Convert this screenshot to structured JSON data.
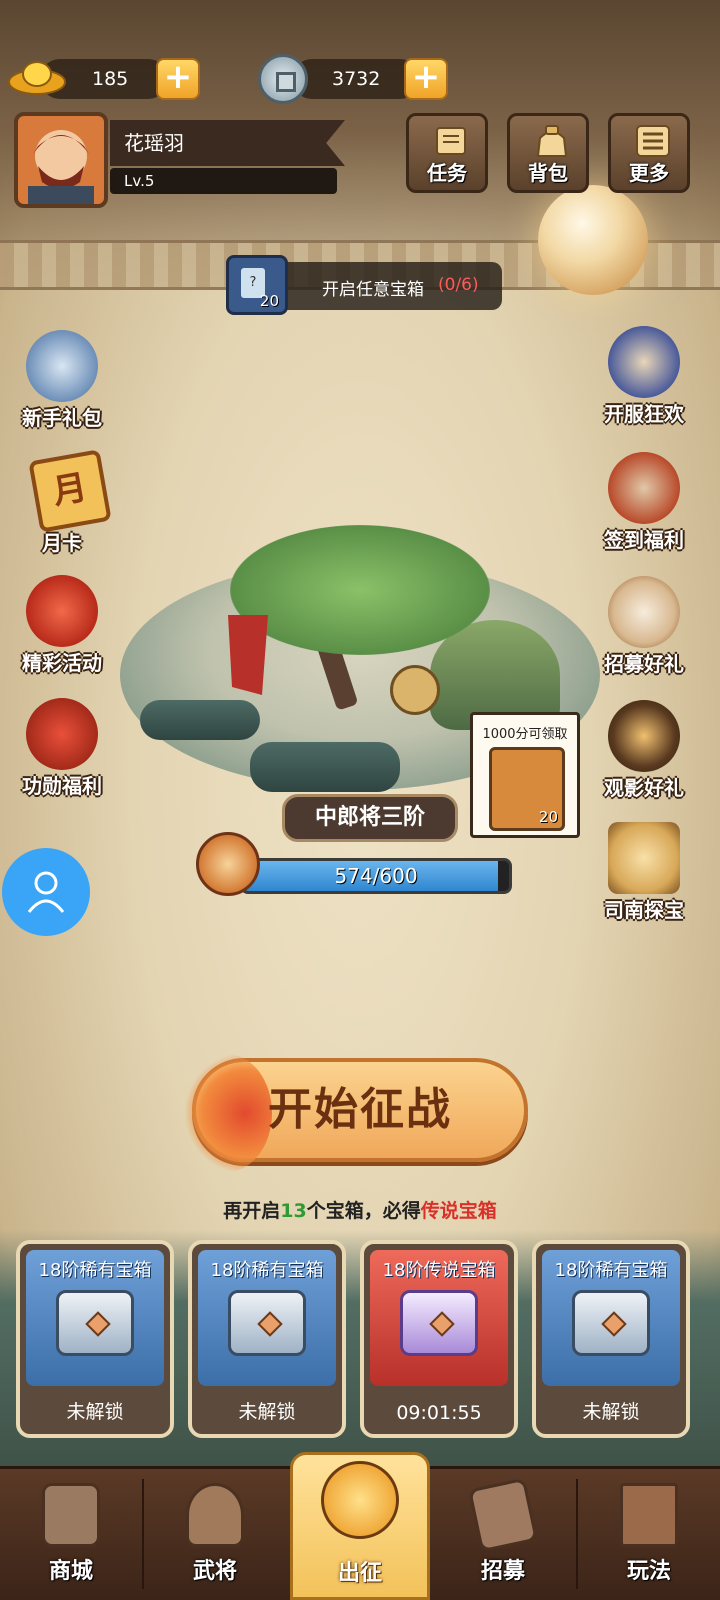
{
  "currency": {
    "gold_value": "185",
    "silver_value": "3732"
  },
  "player": {
    "name": "花瑶羽",
    "level": "Lv.5"
  },
  "top_buttons": [
    {
      "label": "任务",
      "icon": "scroll-icon"
    },
    {
      "label": "背包",
      "icon": "bag-icon"
    },
    {
      "label": "更多",
      "icon": "menu-icon"
    }
  ],
  "quest": {
    "card_count": "20",
    "text": "开启任意宝箱",
    "progress": "(0/6)"
  },
  "left_events": [
    "新手礼包",
    "月卡",
    "精彩活动",
    "功勋福利"
  ],
  "right_events": [
    "开服狂欢",
    "签到福利",
    "招募好礼",
    "观影好礼",
    "司南探宝"
  ],
  "month_card_char": "月",
  "stage": {
    "rank_title": "中郎将三阶",
    "progress_text": "574/600",
    "progress_fraction": 0.957,
    "reward_bubble_text": "1000分可领取",
    "reward_count": "20"
  },
  "start_button": "开始征战",
  "chest_hint": {
    "prefix": "再开启",
    "count": "13",
    "middle": "个宝箱，必得",
    "highlight": "传说宝箱"
  },
  "chests": [
    {
      "title": "18阶稀有宝箱",
      "status": "未解锁",
      "rarity": "rare"
    },
    {
      "title": "18阶稀有宝箱",
      "status": "未解锁",
      "rarity": "rare"
    },
    {
      "title": "18阶传说宝箱",
      "status": "09:01:55",
      "rarity": "legendary"
    },
    {
      "title": "18阶稀有宝箱",
      "status": "未解锁",
      "rarity": "rare"
    }
  ],
  "nav": [
    {
      "label": "商城"
    },
    {
      "label": "武将"
    },
    {
      "label": "出征",
      "active": true
    },
    {
      "label": "招募"
    },
    {
      "label": "玩法"
    }
  ],
  "colors": {
    "rare_blue": "#4f86c6",
    "legendary_red": "#d8423e",
    "progress_blue": "#3a92d8",
    "accent_orange": "#f0a85a"
  }
}
